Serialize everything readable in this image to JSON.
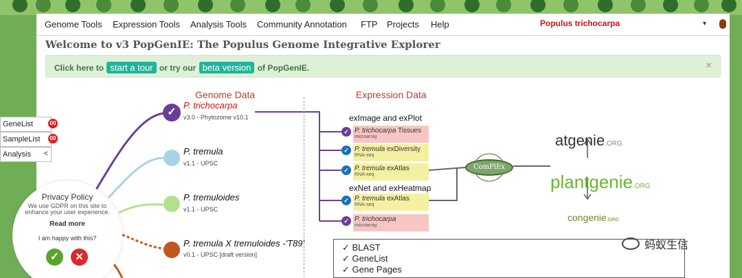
{
  "nav": {
    "items": [
      "Genome Tools",
      "Expression Tools",
      "Analysis Tools",
      "Community Annotation",
      "FTP",
      "Projects",
      "Help"
    ],
    "species": "Populus trichocarpa"
  },
  "welcome": "Welcome to v3 PopGenIE: The Populus Genome Integrative Explorer",
  "alert": {
    "prefix": "Click here to",
    "tour_button": "start a tour",
    "middle": "or try our",
    "beta_button": "beta version",
    "suffix": "of PopGenIE.",
    "close": "×"
  },
  "genome": {
    "title": "Genome Data",
    "entries": [
      {
        "name": "P. trichocarpa",
        "sub": "v3.0 - Phytozome v10.1",
        "color": "#6a3d9a"
      },
      {
        "name": "P. tremula",
        "sub": "v1.1 - UPSC",
        "color": "#a8d3e6"
      },
      {
        "name": "P. tremuloides",
        "sub": "v1.1 - UPSC",
        "color": "#b4e08e"
      },
      {
        "name": "P. tremula X tremuloides -'T89'",
        "sub": "v0.1 - UPSC [draft version]",
        "color": "#c0581f"
      }
    ]
  },
  "expression": {
    "title": "Expression Data",
    "head1": "exImage and exPlot",
    "head2": "exNet and exHeatmap",
    "boxes": [
      {
        "species": "P. trichocarpa",
        "suffix": " Tissues",
        "tech": "microarray",
        "color": "#f7c6c3"
      },
      {
        "species": "P. tremula",
        "suffix": " exDiversity",
        "tech": "RNA-seq",
        "color": "#f4f0a1"
      },
      {
        "species": "P. tremula",
        "suffix": " exAtlas",
        "tech": "RNA-seq",
        "color": "#f4f0a1"
      },
      {
        "species": "P. tremula",
        "suffix": " exAtlas",
        "tech": "RNA-seq",
        "color": "#f4f0a1"
      },
      {
        "species": "P. trichocarpa",
        "suffix": "",
        "tech": "microarray",
        "color": "#f7c6c3"
      }
    ],
    "complex": "ComPlEx"
  },
  "logos": {
    "atgenie": "atgenie",
    "atgenie_suffix": ".ORG",
    "plantgenie": "plantgenie",
    "plantgenie_suffix": ".ORG",
    "congenie": "congenie",
    "congenie_suffix": ".ORG"
  },
  "tools": [
    "✓ BLAST",
    "✓ GeneList",
    "✓ Gene Pages"
  ],
  "float": {
    "genelist": "GeneList",
    "genelist_count": "00",
    "samplelist": "SampleList",
    "samplelist_count": "00",
    "analysis": "Analysis",
    "analysis_caret": "<"
  },
  "privacy": {
    "title": "Privacy Policy",
    "text": "We use GDPR on this site to enhance your user experience.",
    "read_more": "Read more",
    "happy": "I am happy with this?",
    "yes": "✓",
    "no": "✕"
  },
  "watermark": "蚂蚁生信"
}
